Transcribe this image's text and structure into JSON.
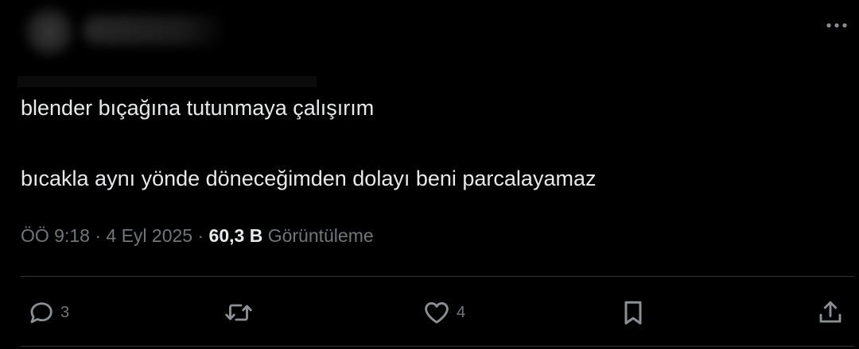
{
  "tweet": {
    "line1": "blender bıçağına tutunmaya çalışırım",
    "line2": "bıcakla aynı yönde döneceğimden dolayı beni parcalayamaz"
  },
  "meta": {
    "time": "ÖÖ 9:18",
    "separator": " · ",
    "date": "4 Eyl 2025",
    "views_count": "60,3 B",
    "views_label": "Görüntüleme"
  },
  "actions": {
    "reply_count": "3",
    "like_count": "4"
  },
  "icons": {
    "more": "more-horizontal-icon",
    "reply": "reply-icon",
    "retweet": "retweet-icon",
    "like": "heart-icon",
    "bookmark": "bookmark-icon",
    "share": "share-icon"
  },
  "colors": {
    "background": "#000000",
    "text": "#e7e9ea",
    "secondary": "#71767b",
    "divider": "#2f3336"
  }
}
